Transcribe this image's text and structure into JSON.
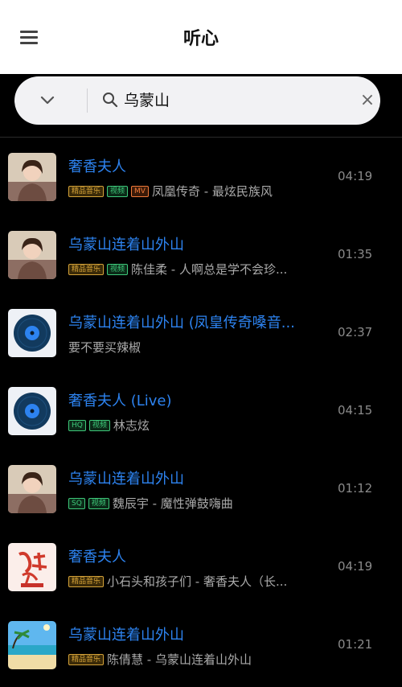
{
  "header": {
    "title": "听心",
    "menu_icon": "hamburger-menu-icon"
  },
  "search": {
    "query": "乌蒙山",
    "dropdown_icon": "chevron-down-icon",
    "search_icon": "search-icon",
    "clear_symbol": "×"
  },
  "colors": {
    "accent": "#2d83f0",
    "badge_gold": "#d4a238",
    "badge_green": "#3ec97a",
    "badge_orange": "#f07a3a"
  },
  "songs": [
    {
      "title": "奢香夫人",
      "badges": [
        "精品音乐",
        "视频",
        "MV"
      ],
      "artist_line": "凤凰传奇 - 最炫民族风",
      "duration": "04:19",
      "cover": "portrait-photo"
    },
    {
      "title": "乌蒙山连着山外山",
      "badges": [
        "精品音乐",
        "视频"
      ],
      "artist_line": "陈佳柔 - 人啊总是学不会珍...",
      "duration": "01:35",
      "cover": "portrait-photo"
    },
    {
      "title": "乌蒙山连着山外山 (凤皇传奇嗓音...",
      "badges": [],
      "artist_line": "要不要买辣椒",
      "duration": "02:37",
      "cover": "vinyl-disc"
    },
    {
      "title": "奢香夫人 (Live)",
      "badges": [
        "HQ",
        "视频"
      ],
      "artist_line": "林志炫",
      "duration": "04:15",
      "cover": "vinyl-disc"
    },
    {
      "title": "乌蒙山连着山外山",
      "badges": [
        "SQ",
        "视频"
      ],
      "artist_line": "魏辰宇 - 魔性弹鼓嗨曲",
      "duration": "01:12",
      "cover": "portrait-photo"
    },
    {
      "title": "奢香夫人",
      "badges": [
        "精品音乐"
      ],
      "artist_line": "小石头和孩子们 - 奢香夫人（长...",
      "duration": "04:19",
      "cover": "calligraphy-art"
    },
    {
      "title": "乌蒙山连着山外山",
      "badges": [
        "精品音乐"
      ],
      "artist_line": "陈倩慧 - 乌蒙山连着山外山",
      "duration": "01:21",
      "cover": "beach-photo"
    }
  ]
}
